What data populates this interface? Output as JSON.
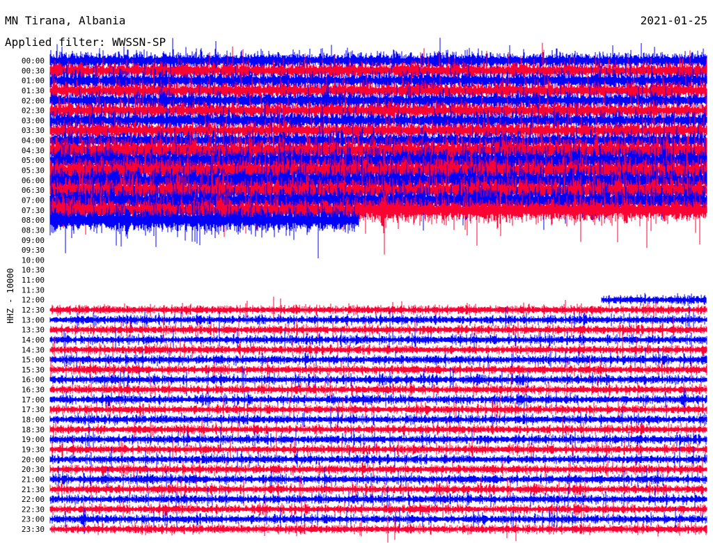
{
  "header": {
    "station": "MN Tirana, Albania",
    "filter": "Applied filter: WWSSN-SP",
    "date": "2021-01-25"
  },
  "chart_data": {
    "type": "line",
    "subtype": "helicorder",
    "title": "MN Tirana, Albania",
    "ylabel": "HHZ - 10000",
    "colors": {
      "blue": "#0000ff",
      "red": "#ff0033"
    },
    "row_labels": [
      "00:00",
      "00:30",
      "01:00",
      "01:30",
      "02:00",
      "02:30",
      "03:00",
      "03:30",
      "04:00",
      "04:30",
      "05:00",
      "05:30",
      "06:00",
      "06:30",
      "07:00",
      "07:30",
      "08:00",
      "08:30",
      "09:00",
      "09:30",
      "10:00",
      "10:30",
      "11:00",
      "11:30",
      "12:00",
      "12:30",
      "13:00",
      "13:30",
      "14:00",
      "14:30",
      "15:00",
      "15:30",
      "16:00",
      "16:30",
      "17:00",
      "17:30",
      "18:00",
      "18:30",
      "19:00",
      "19:30",
      "20:00",
      "20:30",
      "21:00",
      "21:30",
      "22:00",
      "22:30",
      "23:00",
      "23:30"
    ],
    "row_coverage": [
      [
        0,
        1
      ],
      [
        0,
        1
      ],
      [
        0,
        1
      ],
      [
        0,
        1
      ],
      [
        0,
        1
      ],
      [
        0,
        1
      ],
      [
        0,
        1
      ],
      [
        0,
        1
      ],
      [
        0,
        1
      ],
      [
        0,
        1
      ],
      [
        0,
        1
      ],
      [
        0,
        1
      ],
      [
        0,
        1
      ],
      [
        0,
        1
      ],
      [
        0,
        1
      ],
      [
        0,
        1
      ],
      [
        0,
        0.47
      ],
      null,
      null,
      null,
      null,
      null,
      null,
      null,
      [
        0.84,
        1
      ],
      [
        0,
        1
      ],
      [
        0,
        1
      ],
      [
        0,
        1
      ],
      [
        0,
        1
      ],
      [
        0,
        1
      ],
      [
        0,
        1
      ],
      [
        0,
        1
      ],
      [
        0,
        1
      ],
      [
        0,
        1
      ],
      [
        0,
        1
      ],
      [
        0,
        1
      ],
      [
        0,
        1
      ],
      [
        0,
        1
      ],
      [
        0,
        1
      ],
      [
        0,
        1
      ],
      [
        0,
        1
      ],
      [
        0,
        1
      ],
      [
        0,
        1
      ],
      [
        0,
        1
      ],
      [
        0,
        1
      ],
      [
        0,
        1
      ],
      [
        0,
        1
      ],
      [
        0,
        1
      ]
    ],
    "row_amplitude": "high before 08:00, moderate after 12:00"
  }
}
